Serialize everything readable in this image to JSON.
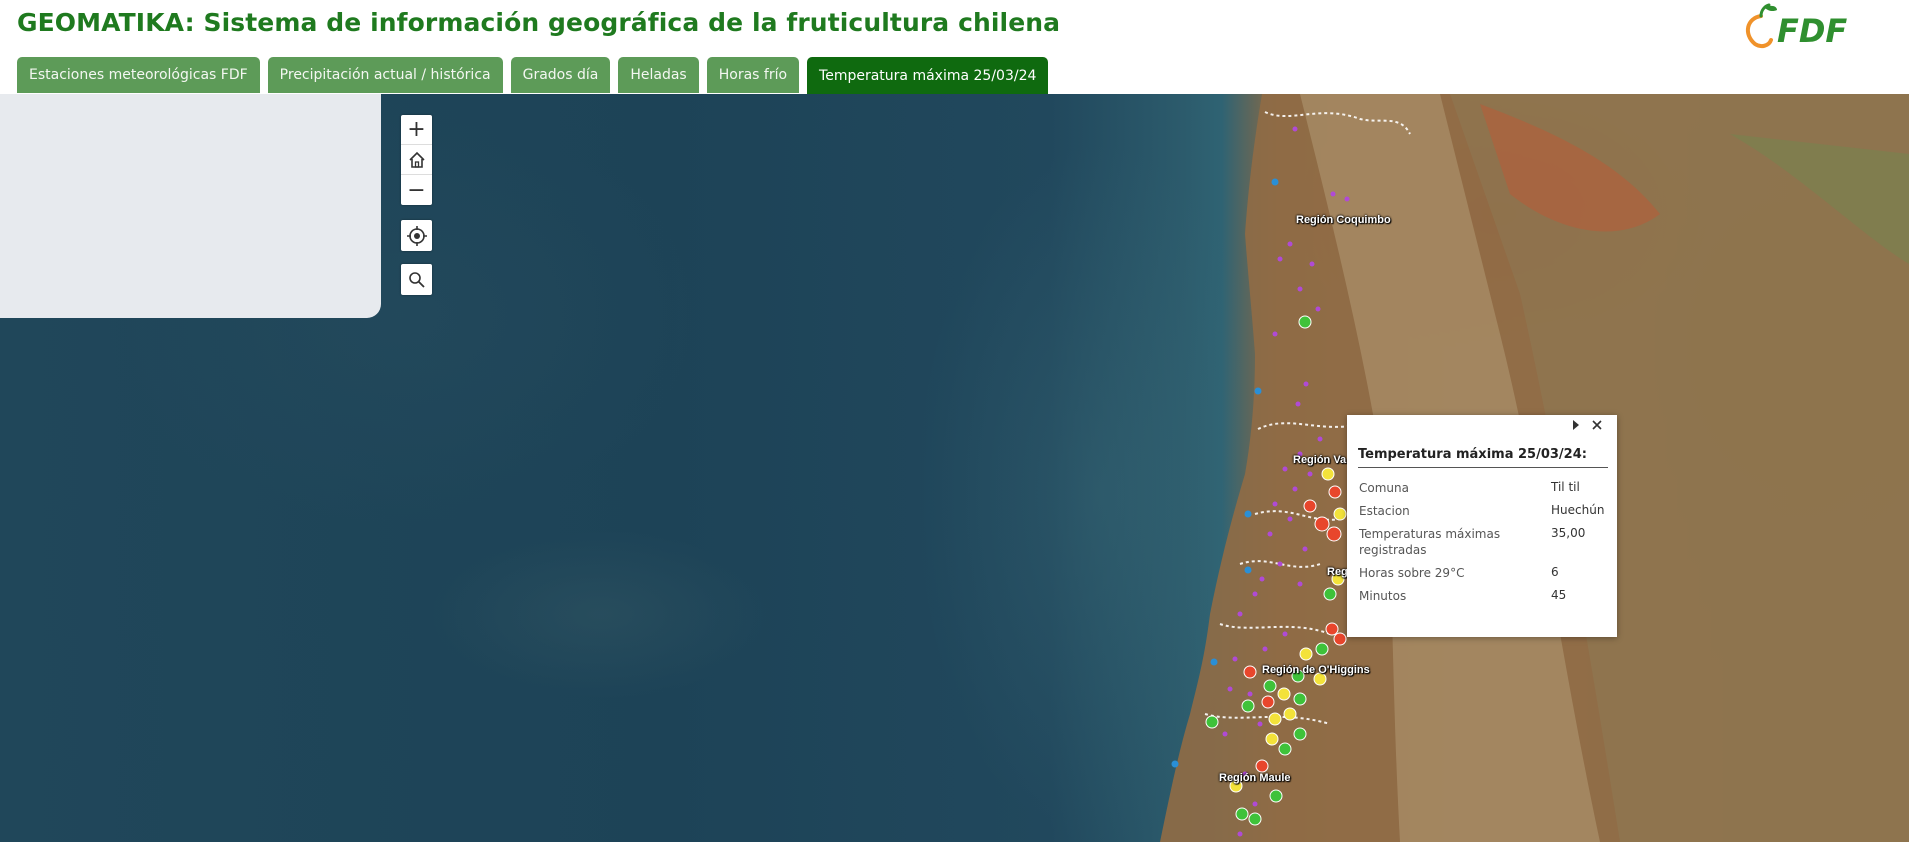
{
  "header": {
    "title": "GEOMATIKA: Sistema de información geográfica de la fruticultura chilena",
    "logo_text": "FDF",
    "brand_color": "#1f7a1f"
  },
  "tabs": [
    {
      "label": "Estaciones meteorológicas FDF",
      "active": false
    },
    {
      "label": "Precipitación actual / histórica",
      "active": false
    },
    {
      "label": "Grados día",
      "active": false
    },
    {
      "label": "Heladas",
      "active": false
    },
    {
      "label": "Horas frío",
      "active": false
    },
    {
      "label": "Temperatura máxima 25/03/24",
      "active": true
    }
  ],
  "map_controls": {
    "zoom_in": "+",
    "home_icon": "home-icon",
    "zoom_out": "−",
    "locate_icon": "locate-icon",
    "search_icon": "search-icon"
  },
  "regions": {
    "coquimbo": "Región Coquimbo",
    "valparaiso": "Región Va",
    "metropolitana": "Regi",
    "ohiggins": "Región de O'Higgins",
    "maule": "Región Maule"
  },
  "popup": {
    "title": "Temperatura máxima 25/03/24:",
    "rows": [
      {
        "key": "Comuna",
        "value": "Til til"
      },
      {
        "key": "Estacion",
        "value": "Huechún"
      },
      {
        "key": "Temperaturas máximas registradas",
        "value": "35,00"
      },
      {
        "key": "Horas sobre 29°C",
        "value": "6"
      },
      {
        "key": "Minutos",
        "value": "45"
      }
    ]
  },
  "marker_colors": {
    "hot": "#e8462c",
    "warm": "#f3e23a",
    "mild": "#3fc23a",
    "station": "#b04ad6",
    "coastal": "#2a8fd6"
  }
}
